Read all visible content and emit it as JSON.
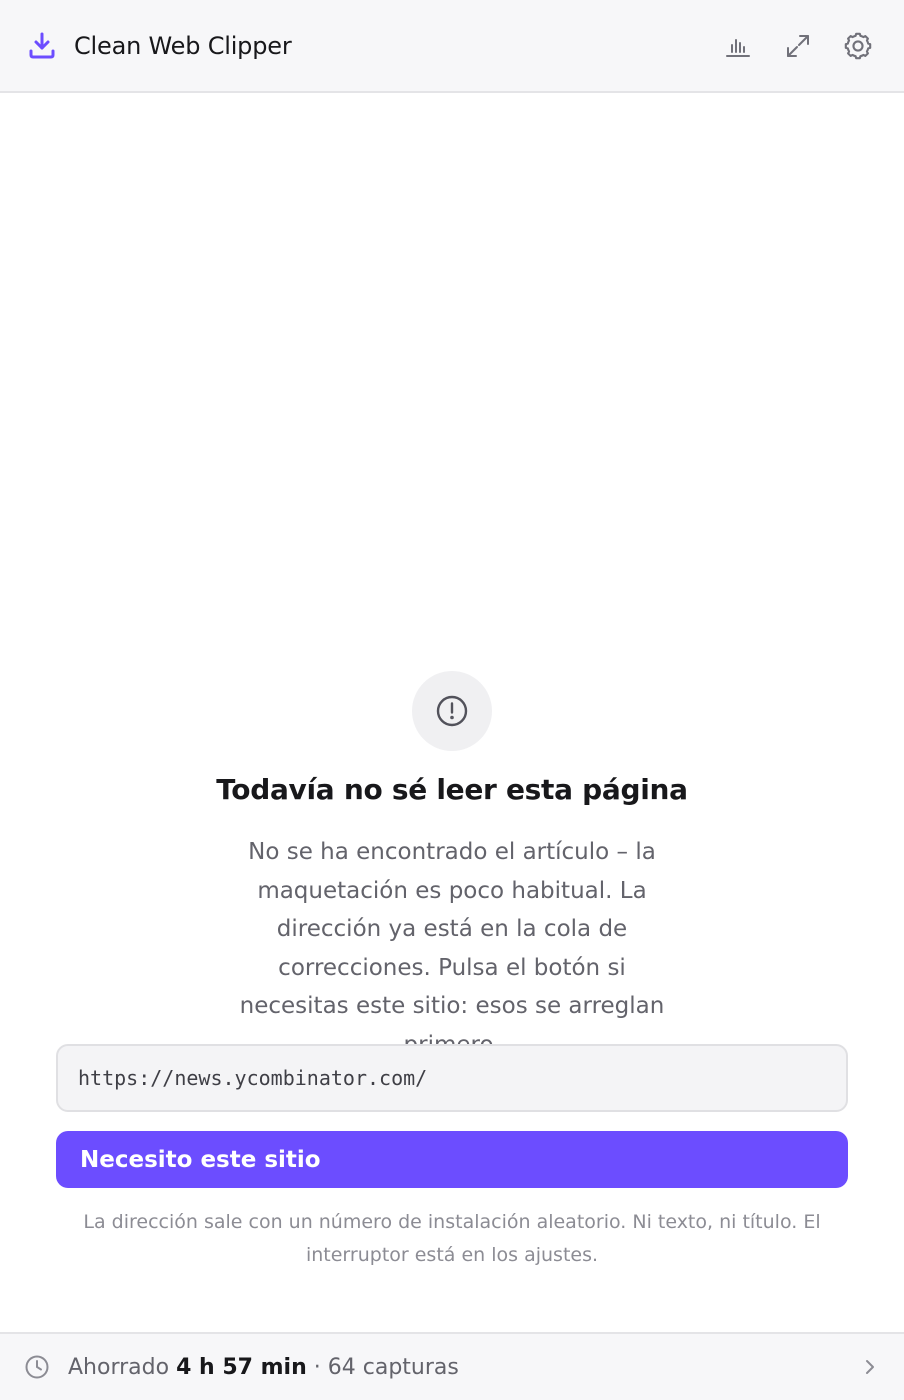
{
  "header": {
    "title": "Clean Web Clipper",
    "logo_icon": "download-icon",
    "actions": [
      {
        "icon": "bar-chart-icon"
      },
      {
        "icon": "expand-icon"
      },
      {
        "icon": "gear-icon"
      }
    ]
  },
  "message": {
    "icon": "alert-circle-icon",
    "heading": "Todavía no sé leer esta página",
    "description": "No se ha encontrado el artículo – la maquetación es poco habitual. La dirección ya está en la cola de correcciones. Pulsa el botón si necesitas este sitio: esos se arreglan primero."
  },
  "url_field": {
    "value": "https://news.ycombinator.com/"
  },
  "primary_button": {
    "label": "Necesito este sitio"
  },
  "footnote": "La dirección sale con un número de instalación aleatorio. Ni texto, ni título. El interruptor está en los ajustes.",
  "footer": {
    "icon": "clock-icon",
    "prefix": "Ahorrado",
    "time_saved": "4 h 57 min",
    "separator": "·",
    "captures": "64 capturas",
    "chevron_icon": "chevron-right-icon"
  },
  "colors": {
    "accent": "#6c4dff",
    "header_bg": "#f7f7f9",
    "muted_text": "#63636b"
  }
}
